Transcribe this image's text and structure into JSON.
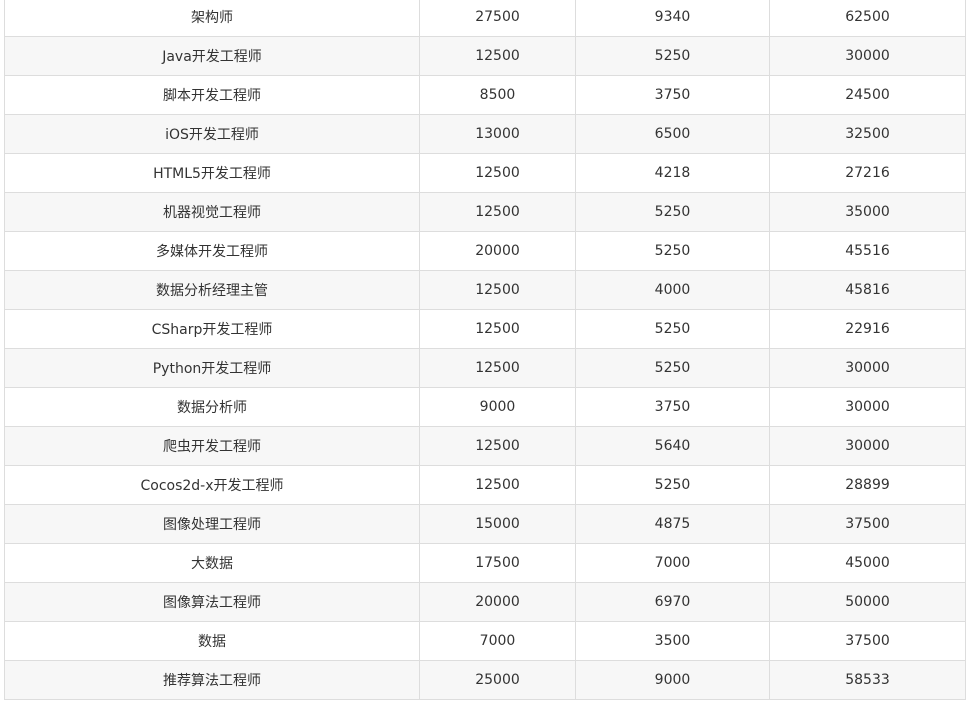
{
  "rows": [
    [
      "架构师",
      "27500",
      "9340",
      "62500"
    ],
    [
      "Java开发工程师",
      "12500",
      "5250",
      "30000"
    ],
    [
      "脚本开发工程师",
      "8500",
      "3750",
      "24500"
    ],
    [
      "iOS开发工程师",
      "13000",
      "6500",
      "32500"
    ],
    [
      "HTML5开发工程师",
      "12500",
      "4218",
      "27216"
    ],
    [
      "机器视觉工程师",
      "12500",
      "5250",
      "35000"
    ],
    [
      "多媒体开发工程师",
      "20000",
      "5250",
      "45516"
    ],
    [
      "数据分析经理主管",
      "12500",
      "4000",
      "45816"
    ],
    [
      "CSharp开发工程师",
      "12500",
      "5250",
      "22916"
    ],
    [
      "Python开发工程师",
      "12500",
      "5250",
      "30000"
    ],
    [
      "数据分析师",
      "9000",
      "3750",
      "30000"
    ],
    [
      "爬虫开发工程师",
      "12500",
      "5640",
      "30000"
    ],
    [
      "Cocos2d-x开发工程师",
      "12500",
      "5250",
      "28899"
    ],
    [
      "图像处理工程师",
      "15000",
      "4875",
      "37500"
    ],
    [
      "大数据",
      "17500",
      "7000",
      "45000"
    ],
    [
      "图像算法工程师",
      "20000",
      "6970",
      "50000"
    ],
    [
      "数据",
      "7000",
      "3500",
      "37500"
    ],
    [
      "推荐算法工程师",
      "25000",
      "9000",
      "58533"
    ]
  ]
}
